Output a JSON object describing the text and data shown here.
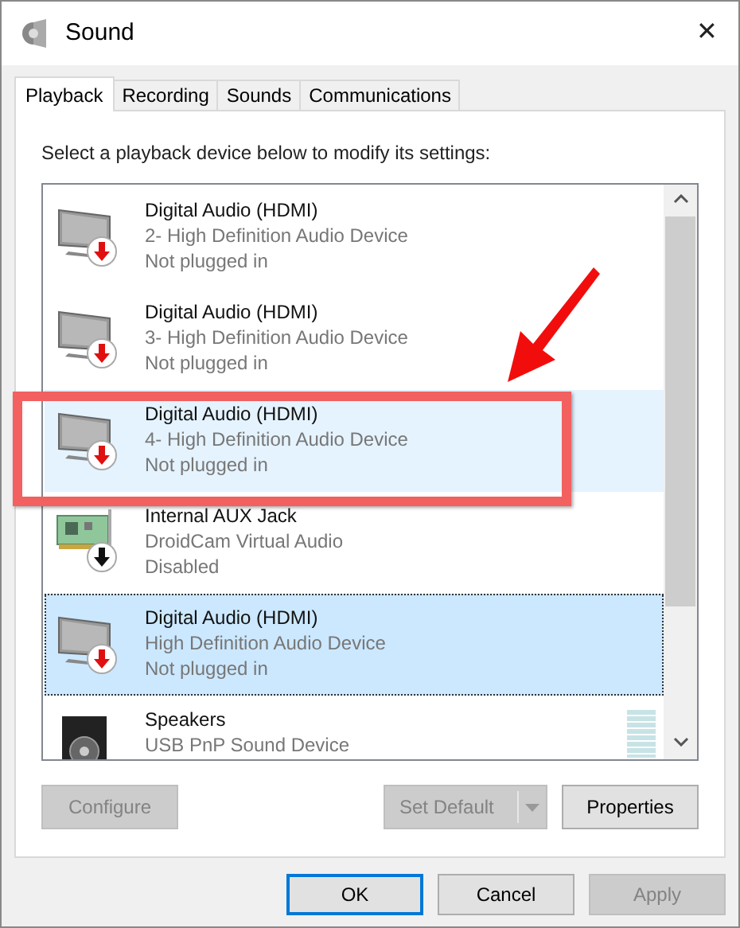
{
  "window": {
    "title": "Sound",
    "close": "✕"
  },
  "tabs": [
    {
      "label": "Playback",
      "selected": true
    },
    {
      "label": "Recording",
      "selected": false
    },
    {
      "label": "Sounds",
      "selected": false
    },
    {
      "label": "Communications",
      "selected": false
    }
  ],
  "instruction": "Select a playback device below to modify its settings:",
  "devices": [
    {
      "kind": "monitor",
      "name": "Digital Audio (HDMI)",
      "detail": "2- High Definition Audio Device",
      "status": "Not plugged in",
      "badge": {
        "kind": "unplugged"
      },
      "selected": false,
      "highlighted": false
    },
    {
      "kind": "monitor",
      "name": "Digital Audio (HDMI)",
      "detail": "3- High Definition Audio Device",
      "status": "Not plugged in",
      "badge": {
        "kind": "unplugged"
      },
      "selected": false,
      "highlighted": false
    },
    {
      "kind": "monitor",
      "name": "Digital Audio (HDMI)",
      "detail": "4- High Definition Audio Device",
      "status": "Not plugged in",
      "badge": {
        "kind": "unplugged"
      },
      "selected": false,
      "highlighted": true
    },
    {
      "kind": "card",
      "name": "Internal AUX Jack",
      "detail": "DroidCam Virtual Audio",
      "status": "Disabled",
      "badge": {
        "kind": "disabled"
      },
      "selected": false,
      "highlighted": false
    },
    {
      "kind": "monitor",
      "name": "Digital Audio (HDMI)",
      "detail": "High Definition Audio Device",
      "status": "Not plugged in",
      "badge": {
        "kind": "unplugged"
      },
      "selected": true,
      "highlighted": false
    },
    {
      "kind": "speaker",
      "name": "Speakers",
      "detail": "USB PnP Sound Device",
      "selected": false,
      "highlighted": false
    }
  ],
  "buttons": [
    {
      "label": "Configure",
      "disabled": true
    },
    {
      "label": "Set Default",
      "disabled": true
    },
    {
      "label": "Properties",
      "disabled": false
    }
  ],
  "dialog_buttons": [
    {
      "label": "OK",
      "disabled": false,
      "default": true
    },
    {
      "label": "Cancel",
      "disabled": false,
      "default": false
    },
    {
      "label": "Apply",
      "disabled": true,
      "default": false
    }
  ]
}
